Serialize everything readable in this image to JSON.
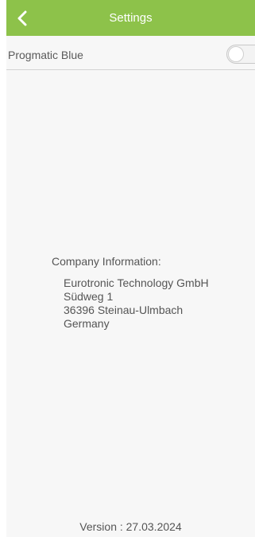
{
  "header": {
    "title": "Settings",
    "back_icon": "chevron-left-icon",
    "color": "#8dc24a"
  },
  "settings": {
    "progmatic_blue": {
      "label": "Progmatic Blue",
      "enabled": false
    }
  },
  "company": {
    "heading": "Company Information:",
    "name": "Eurotronic Technology GmbH",
    "street": "Südweg 1",
    "city": "36396 Steinau-Ulmbach",
    "country": "Germany"
  },
  "footer": {
    "version": "Version : 27.03.2024"
  }
}
